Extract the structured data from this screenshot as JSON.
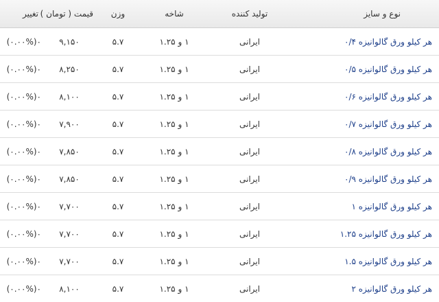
{
  "table": {
    "headers": {
      "type": "نوع و سایز",
      "producer": "تولید کننده",
      "branch": "شاخه",
      "weight": "وزن",
      "price": "قیمت ( تومان )",
      "change": "تغییر"
    },
    "rows": [
      {
        "type": "هر کیلو ورق گالوانیزه ۰/۴",
        "producer": "ایرانی",
        "branch": "۱ و ۱.۲۵",
        "weight": "۵.۷",
        "price": "۹,۱۵۰",
        "change": "۰(۰.۰۰%)"
      },
      {
        "type": "هر کیلو ورق گالوانیزه ۰/۵",
        "producer": "ایرانی",
        "branch": "۱ و ۱.۲۵",
        "weight": "۵.۷",
        "price": "۸,۲۵۰",
        "change": "۰(۰.۰۰%)"
      },
      {
        "type": "هر کیلو ورق گالوانیزه ۰/۶",
        "producer": "ایرانی",
        "branch": "۱ و ۱.۲۵",
        "weight": "۵.۷",
        "price": "۸,۱۰۰",
        "change": "۰(۰.۰۰%)"
      },
      {
        "type": "هر کیلو ورق گالوانیزه ۰/۷",
        "producer": "ایرانی",
        "branch": "۱ و ۱.۲۵",
        "weight": "۵.۷",
        "price": "۷,۹۰۰",
        "change": "۰(۰.۰۰%)"
      },
      {
        "type": "هر کیلو ورق گالوانیزه ۰/۸",
        "producer": "ایرانی",
        "branch": "۱ و ۱.۲۵",
        "weight": "۵.۷",
        "price": "۷,۸۵۰",
        "change": "۰(۰.۰۰%)"
      },
      {
        "type": "هر کیلو ورق گالوانیزه ۰/۹",
        "producer": "ایرانی",
        "branch": "۱ و ۱.۲۵",
        "weight": "۵.۷",
        "price": "۷,۸۵۰",
        "change": "۰(۰.۰۰%)"
      },
      {
        "type": "هر کیلو ورق گالوانیزه ۱",
        "producer": "ایرانی",
        "branch": "۱ و ۱.۲۵",
        "weight": "۵.۷",
        "price": "۷,۷۰۰",
        "change": "۰(۰.۰۰%)"
      },
      {
        "type": "هر کیلو ورق گالوانیزه ۱.۲۵",
        "producer": "ایرانی",
        "branch": "۱ و ۱.۲۵",
        "weight": "۵.۷",
        "price": "۷,۷۰۰",
        "change": "۰(۰.۰۰%)"
      },
      {
        "type": "هر کیلو ورق گالوانیزه ۱.۵",
        "producer": "ایرانی",
        "branch": "۱ و ۱.۲۵",
        "weight": "۵.۷",
        "price": "۷,۷۰۰",
        "change": "۰(۰.۰۰%)"
      },
      {
        "type": "هر کیلو ورق گالوانیزه ۲",
        "producer": "ایرانی",
        "branch": "۱ و ۱.۲۵",
        "weight": "۵.۷",
        "price": "۸,۱۰۰",
        "change": "۰(۰.۰۰%)"
      }
    ]
  },
  "colors": {
    "link": "#1d3f8a",
    "header_bg": "#ececec",
    "row_border": "#dcdcdc"
  }
}
